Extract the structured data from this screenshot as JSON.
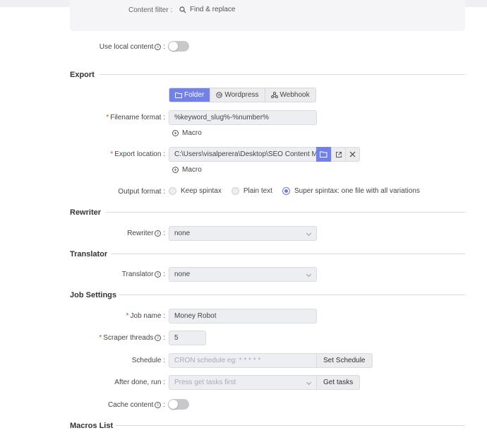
{
  "content_filter": {
    "label": "Content filter :",
    "action_label": "Find & replace",
    "action_icon": "search-icon"
  },
  "use_local_content": {
    "label": "Use local content",
    "suffix": ":",
    "value": false
  },
  "export": {
    "section_title": "Export",
    "tabs": [
      {
        "label": "Folder",
        "icon": "folder-icon",
        "active": true
      },
      {
        "label": "Wordpress",
        "icon": "wordpress-icon",
        "active": false
      },
      {
        "label": "Webhook",
        "icon": "webhook-icon",
        "active": false
      }
    ],
    "filename_format": {
      "label": "Filename format",
      "value": "%keyword_slug%-%number%",
      "macro_label": "Macro"
    },
    "export_location": {
      "label": "Export location",
      "value": "C:\\Users\\visalperera\\Desktop\\SEO Content Machine",
      "macro_label": "Macro"
    },
    "output_format": {
      "label": "Output format",
      "options": [
        {
          "label": "Keep spintax",
          "checked": false
        },
        {
          "label": "Plain text",
          "checked": false
        },
        {
          "label": "Super spintax: one file with all variations",
          "checked": true
        }
      ]
    }
  },
  "rewriter": {
    "section_title": "Rewriter",
    "label": "Rewriter",
    "value": "none"
  },
  "translator": {
    "section_title": "Translator",
    "label": "Translator",
    "value": "none"
  },
  "job_settings": {
    "section_title": "Job Settings",
    "job_name": {
      "label": "Job name",
      "value": "Money Robot"
    },
    "scraper_threads": {
      "label": "Scraper threads",
      "value": "5"
    },
    "schedule": {
      "label": "Schedule",
      "placeholder": "CRON schedule eg: * * * * *",
      "button_label": "Set Schedule"
    },
    "after_done": {
      "label": "After done, run",
      "placeholder": "Press get tasks first",
      "button_label": "Get tasks"
    },
    "cache_content": {
      "label": "Cache content",
      "value": false
    }
  },
  "macros_list": {
    "section_title": "Macros List"
  },
  "colors": {
    "accent": "#7281e8",
    "required": "#e0453a"
  }
}
